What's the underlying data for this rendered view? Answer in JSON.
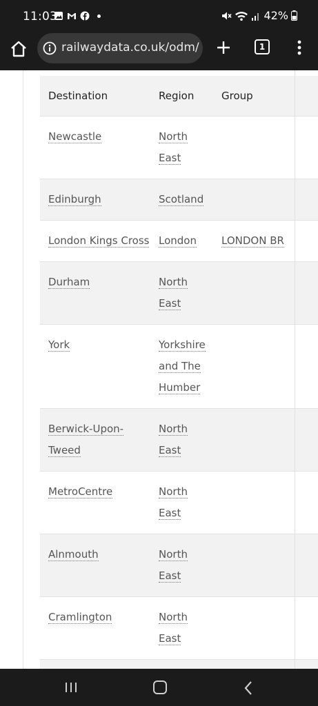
{
  "status_bar": {
    "time": "11:03",
    "battery": "42%"
  },
  "browser": {
    "url": "railwaydata.co.uk/odm/",
    "tab_count": "1"
  },
  "table": {
    "headers": [
      "Destination",
      "Region",
      "Group"
    ],
    "rows": [
      {
        "destination": "Newcastle",
        "region": "North East",
        "group": ""
      },
      {
        "destination": "Edinburgh",
        "region": "Scotland",
        "group": ""
      },
      {
        "destination": "London Kings Cross",
        "region": "London",
        "group": "LONDON BR"
      },
      {
        "destination": "Durham",
        "region": "North East",
        "group": ""
      },
      {
        "destination": "York",
        "region": "Yorkshire and The Humber",
        "group": ""
      },
      {
        "destination": "Berwick-Upon-Tweed",
        "region": "North East",
        "group": ""
      },
      {
        "destination": "MetroCentre",
        "region": "North East",
        "group": ""
      },
      {
        "destination": "Alnmouth",
        "region": "North East",
        "group": ""
      },
      {
        "destination": "Cramlington",
        "region": "North East",
        "group": ""
      }
    ]
  }
}
